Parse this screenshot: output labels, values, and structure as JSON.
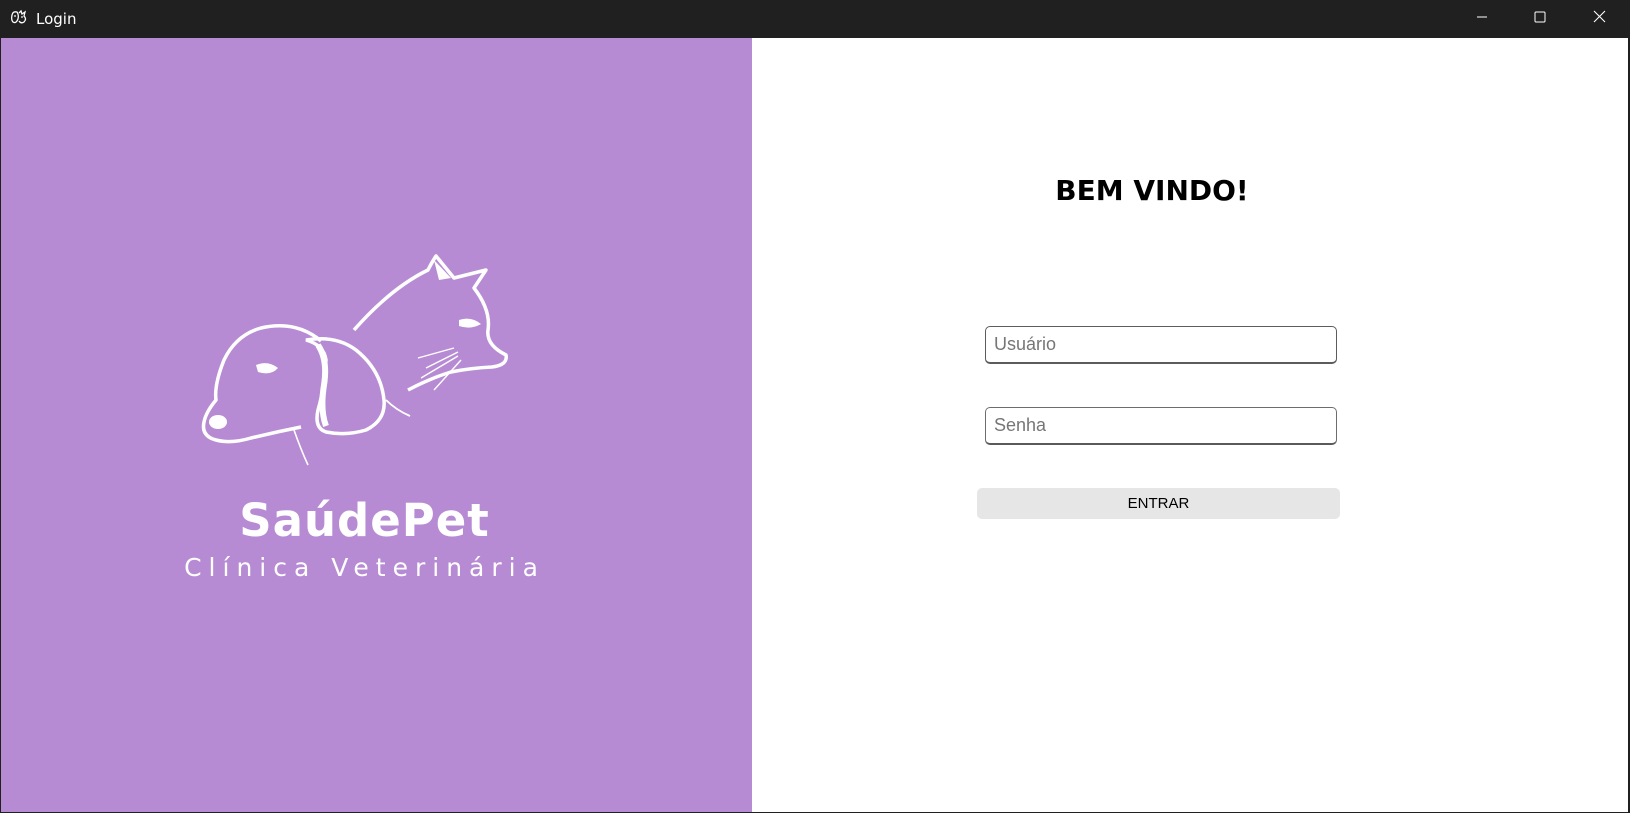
{
  "window": {
    "title": "Login",
    "icon": "dog-cat-app-icon",
    "controls": [
      "minimize-icon",
      "maximize-icon",
      "close-icon"
    ]
  },
  "brand": {
    "name": "SaúdePet",
    "tagline": "Clínica Veterinária",
    "logo_icon": "dog-and-cat-silhouette",
    "panel_color": "#b78bd4"
  },
  "login": {
    "heading": "BEM VINDO!",
    "username_placeholder": "Usuário",
    "username_value": "",
    "password_placeholder": "Senha",
    "password_value": "",
    "submit_label": "ENTRAR"
  }
}
